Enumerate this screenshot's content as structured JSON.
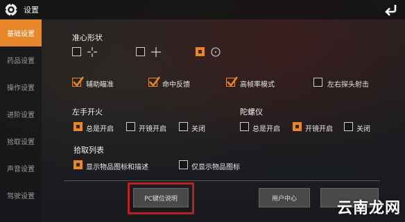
{
  "header": {
    "title": "设置"
  },
  "sidebar": {
    "items": [
      {
        "label": "基础设置"
      },
      {
        "label": "药品设置"
      },
      {
        "label": "操作设置"
      },
      {
        "label": "进阶设置"
      },
      {
        "label": "拾取设置"
      },
      {
        "label": "声音设置"
      },
      {
        "label": "驾驶设置"
      }
    ]
  },
  "crosshair": {
    "title": "准心形状"
  },
  "toggles": {
    "aim_assist": "辅助瞄准",
    "hit_feedback": "命中反馈",
    "high_fps": "高帧率模式",
    "lean_fire": "左右探头射击"
  },
  "left_fire": {
    "title": "左手开火",
    "options": [
      "总是开启",
      "开镜开启",
      "关闭"
    ]
  },
  "gyro": {
    "title": "陀螺仪",
    "options": [
      "总是开启",
      "开镜开启",
      "关闭"
    ]
  },
  "pickup": {
    "title": "拾取列表",
    "options": [
      "显示物品图标和描述",
      "仅显示物品图标"
    ]
  },
  "buttons": {
    "pc_keys": "PC键位说明",
    "user_center": "用户中心"
  },
  "watermark": {
    "text": "云南龙网"
  },
  "colors": {
    "accent": "#e8872a",
    "highlight": "#c01f1f"
  }
}
